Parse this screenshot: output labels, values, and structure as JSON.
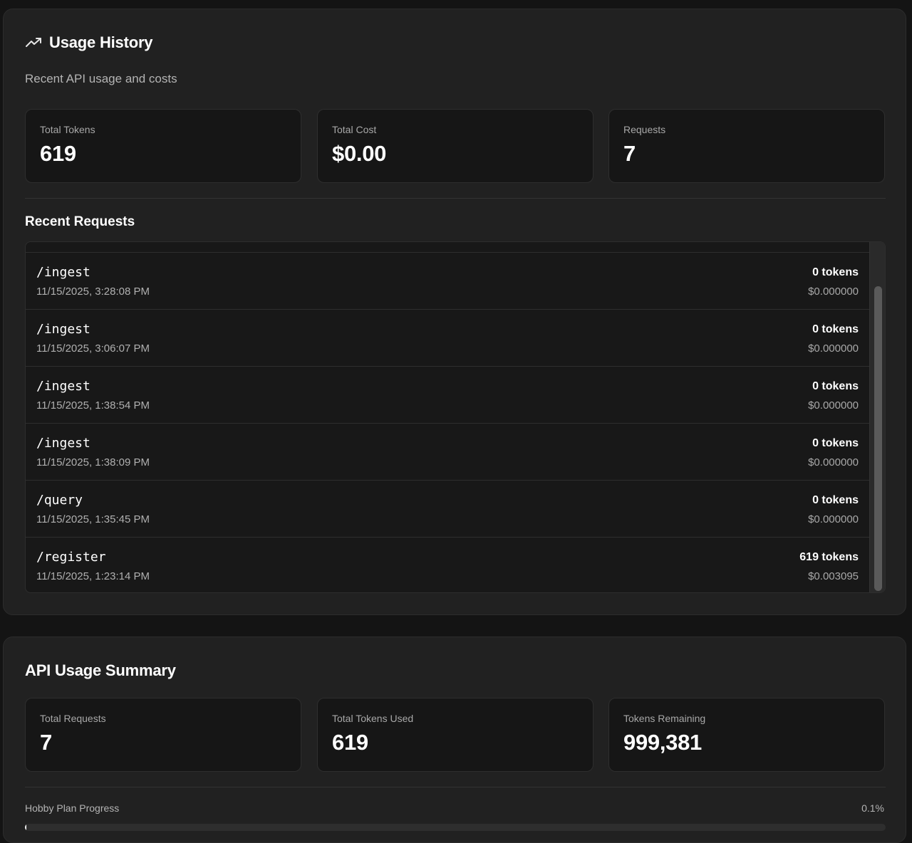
{
  "usage_history": {
    "title": "Usage History",
    "subtitle": "Recent API usage and costs",
    "stats": [
      {
        "label": "Total Tokens",
        "value": "619"
      },
      {
        "label": "Total Cost",
        "value": "$0.00"
      },
      {
        "label": "Requests",
        "value": "7"
      }
    ],
    "recent_title": "Recent Requests",
    "requests": [
      {
        "endpoint": "/ingest",
        "time": "11/15/2025, 3:28:08 PM",
        "tokens": "0 tokens",
        "cost": "$0.000000"
      },
      {
        "endpoint": "/ingest",
        "time": "11/15/2025, 3:06:07 PM",
        "tokens": "0 tokens",
        "cost": "$0.000000"
      },
      {
        "endpoint": "/ingest",
        "time": "11/15/2025, 1:38:54 PM",
        "tokens": "0 tokens",
        "cost": "$0.000000"
      },
      {
        "endpoint": "/ingest",
        "time": "11/15/2025, 1:38:09 PM",
        "tokens": "0 tokens",
        "cost": "$0.000000"
      },
      {
        "endpoint": "/query",
        "time": "11/15/2025, 1:35:45 PM",
        "tokens": "0 tokens",
        "cost": "$0.000000"
      },
      {
        "endpoint": "/register",
        "time": "11/15/2025, 1:23:14 PM",
        "tokens": "619 tokens",
        "cost": "$0.003095"
      }
    ],
    "icon": "trending-up-icon"
  },
  "api_summary": {
    "title": "API Usage Summary",
    "stats": [
      {
        "label": "Total Requests",
        "value": "7"
      },
      {
        "label": "Total Tokens Used",
        "value": "619"
      },
      {
        "label": "Tokens Remaining",
        "value": "999,381"
      }
    ],
    "progress": {
      "label": "Hobby Plan Progress",
      "value_text": "0.1%",
      "fraction": 0.001
    }
  },
  "colors": {
    "page_bg": "#141414",
    "card_bg": "#212121",
    "stat_bg": "#161616",
    "text_primary": "#ffffff",
    "text_muted": "#b0b0b0"
  }
}
